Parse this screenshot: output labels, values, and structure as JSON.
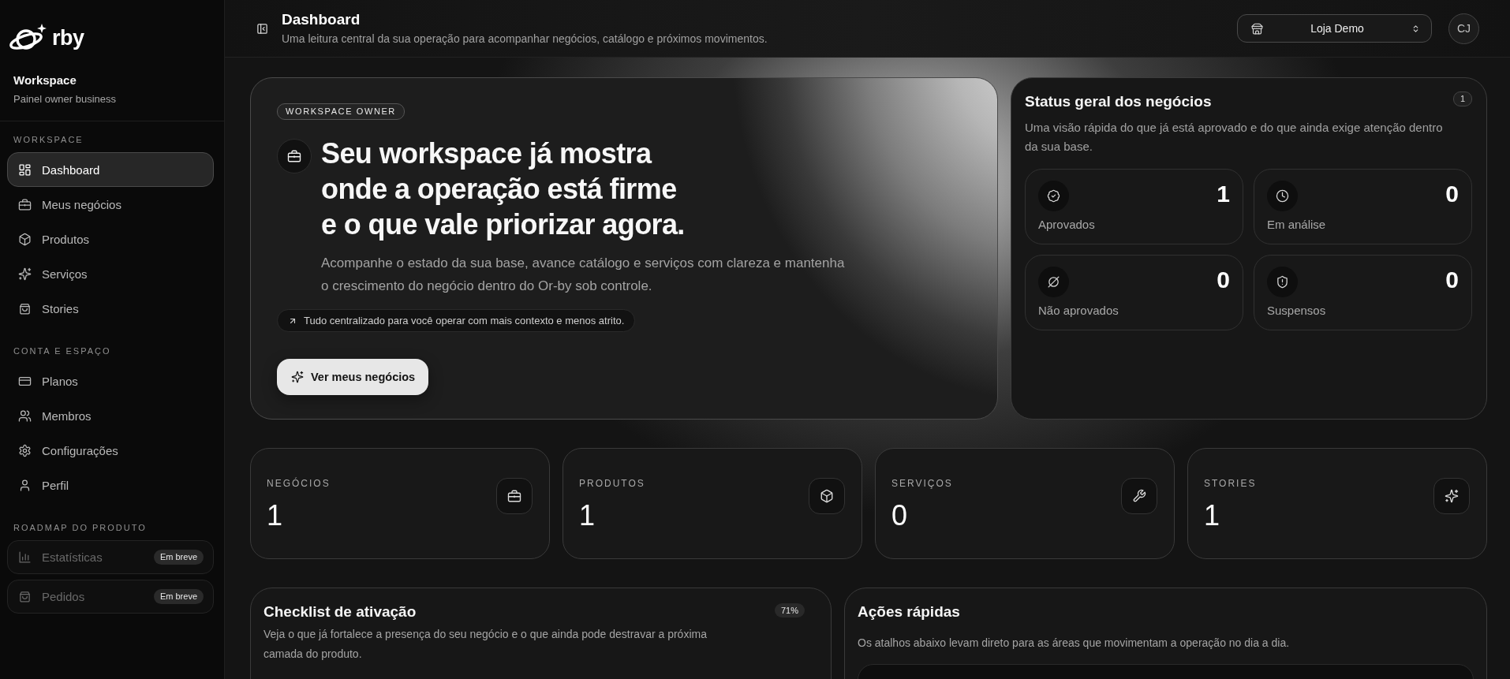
{
  "sidebar": {
    "logo": {
      "text": "rby"
    },
    "workspace": {
      "title": "Workspace",
      "subtitle": "Painel owner business"
    },
    "sections": [
      {
        "label": "WORKSPACE",
        "items": [
          {
            "label": "Dashboard",
            "selected": true,
            "disabled": false
          },
          {
            "label": "Meus negócios",
            "selected": false,
            "disabled": false
          },
          {
            "label": "Produtos",
            "selected": false,
            "disabled": false
          },
          {
            "label": "Serviços",
            "selected": false,
            "disabled": false
          },
          {
            "label": "Stories",
            "selected": false,
            "disabled": false
          }
        ]
      },
      {
        "label": "CONTA E ESPAÇO",
        "items": [
          {
            "label": "Planos",
            "selected": false,
            "disabled": false
          },
          {
            "label": "Membros",
            "selected": false,
            "disabled": false
          },
          {
            "label": "Configurações",
            "selected": false,
            "disabled": false
          },
          {
            "label": "Perfil",
            "selected": false,
            "disabled": false
          }
        ]
      },
      {
        "label": "ROADMAP DO PRODUTO",
        "items": [
          {
            "label": "Estatísticas",
            "selected": false,
            "disabled": true,
            "badge": "Em breve"
          },
          {
            "label": "Pedidos",
            "selected": false,
            "disabled": true,
            "badge": "Em breve"
          }
        ]
      }
    ]
  },
  "header": {
    "title": "Dashboard",
    "subtitle": "Uma leitura central da sua operação para acompanhar negócios, catálogo e próximos movimentos.",
    "store_selector": {
      "value": "Loja Demo"
    },
    "avatar": {
      "initials": "CJ"
    }
  },
  "hero": {
    "badge": "WORKSPACE OWNER",
    "title": "Seu workspace já mostra\nonde a operação está firme\ne o que vale priorizar agora.",
    "description": "Acompanhe o estado da sua base, avance catálogo e serviços com clareza e mantenha o crescimento do negócio dentro do Or-by sob controle.",
    "note": "Tudo centralizado para você operar com mais contexto e menos atrito.",
    "button": "Ver meus negócios"
  },
  "status": {
    "title": "Status geral dos negócios",
    "count": "1",
    "description": "Uma visão rápida do que já está aprovado e do que ainda exige atenção dentro da sua base.",
    "items": [
      {
        "label": "Aprovados",
        "value": "1"
      },
      {
        "label": "Em análise",
        "value": "0"
      },
      {
        "label": "Não aprovados",
        "value": "0"
      },
      {
        "label": "Suspensos",
        "value": "0"
      }
    ]
  },
  "stats": [
    {
      "label": "NEGÓCIOS",
      "value": "1"
    },
    {
      "label": "PRODUTOS",
      "value": "1"
    },
    {
      "label": "SERVIÇOS",
      "value": "0"
    },
    {
      "label": "STORIES",
      "value": "1"
    }
  ],
  "checklist": {
    "title": "Checklist de ativação",
    "badge": "71%",
    "description": "Veja o que já fortalece a presença do seu negócio e o que ainda pode destravar a próxima camada do produto."
  },
  "quick_actions": {
    "title": "Ações rápidas",
    "description": "Os atalhos abaixo levam direto para as áreas que movimentam a operação no dia a dia."
  }
}
